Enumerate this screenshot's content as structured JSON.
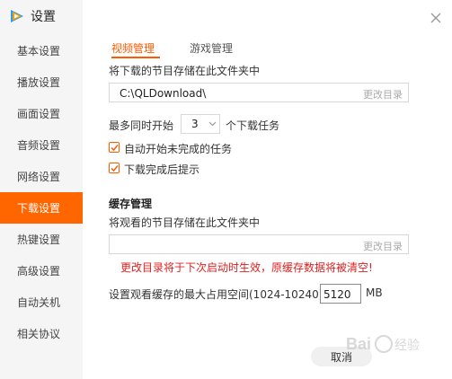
{
  "app": {
    "title": "设置",
    "logo_icon": "tencent-video-logo",
    "brand_color": "#ff6600"
  },
  "sidebar": {
    "items": [
      {
        "label": "基本设置"
      },
      {
        "label": "播放设置"
      },
      {
        "label": "画面设置"
      },
      {
        "label": "音频设置"
      },
      {
        "label": "网络设置"
      },
      {
        "label": "下载设置"
      },
      {
        "label": "热键设置"
      },
      {
        "label": "高级设置"
      },
      {
        "label": "自动关机"
      },
      {
        "label": "相关协议"
      }
    ],
    "active_index": 5
  },
  "tabs": [
    {
      "label": "视频管理",
      "active": true
    },
    {
      "label": "游戏管理",
      "active": false
    }
  ],
  "download": {
    "dir_label": "将下载的节目存储在此文件夹中",
    "dir_value": "C:\\QLDownload\\",
    "change_dir": "更改目录",
    "max_prefix": "最多同时开始",
    "max_value": "3",
    "max_suffix": "个下载任务",
    "auto_start": "自动开始未完成的任务",
    "auto_start_checked": true,
    "notify": "下载完成后提示",
    "notify_checked": true
  },
  "cache": {
    "title": "缓存管理",
    "dir_label": "将观看的节目存储在此文件夹中",
    "dir_value": "",
    "change_dir": "更改目录",
    "warning": "更改目录将于下次启动时生效，原缓存数据将被清空!",
    "max_label": "设置观看缓存的最大占用空间(1024-10240)",
    "max_value": "5120",
    "unit": "MB"
  },
  "footer": {
    "cancel": "取消"
  },
  "watermark": {
    "text": "Bai 经验"
  },
  "colors": {
    "accent": "#ff5a00",
    "warning": "#e02020",
    "sidebar_bg": "#f5f5f5"
  }
}
